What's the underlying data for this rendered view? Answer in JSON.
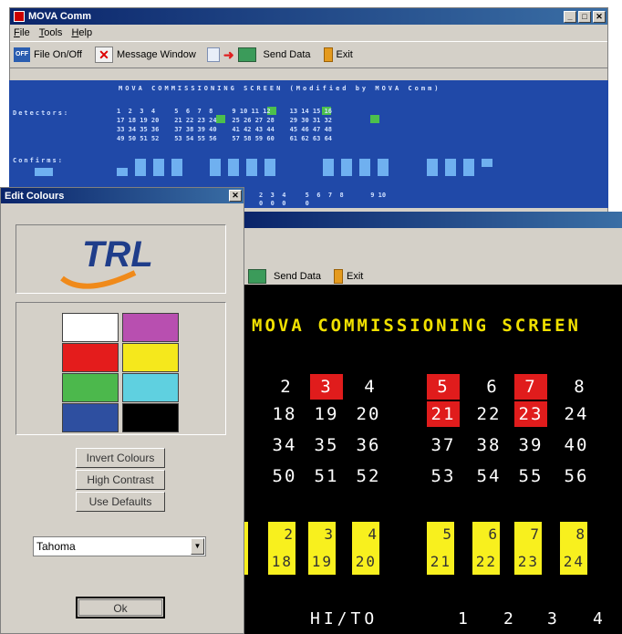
{
  "main_window": {
    "title": "MOVA Comm",
    "menu": [
      "File",
      "Tools",
      "Help"
    ],
    "toolbar": {
      "file_onoff": "File On/Off",
      "off_icon_text": "OFF",
      "message_window": "Message Window",
      "send_data": "Send Data",
      "exit": "Exit"
    }
  },
  "blue_screen": {
    "title": "MOVA COMMISSIONING SCREEN (Modified by MOVA Comm)",
    "detectors_label": "Detectors:",
    "confirms_label": "Confirms:",
    "detector_rows": [
      "1  2  3  4     5  6  7  8     9 10 11 12     13 14 15 16",
      "17 18 19 20    21 22 23 24    25 26 27 28    29 30 31 32",
      "33 34 35 36    37 38 39 40    41 42 43 44    45 46 47 48",
      "49 50 51 52    53 54 55 56    57 58 59 60    61 62 63 64"
    ],
    "lower_row_1": "2  3  4     5  6  7  8       9 10",
    "lower_row_2": "0  0  0     0"
  },
  "edit_colours": {
    "title": "Edit Colours",
    "logo_text": "TRL",
    "swatches": [
      "#ffffff",
      "#b84fb0",
      "#e41c1c",
      "#f5e81c",
      "#4cb84c",
      "#5fd0e0",
      "#2e4fa0",
      "#000000"
    ],
    "buttons": {
      "invert": "Invert Colours",
      "high_contrast": "High Contrast",
      "defaults": "Use Defaults"
    },
    "font_select": "Tahoma",
    "ok": "Ok"
  },
  "black_screen": {
    "toolbar_send": "Send Data",
    "toolbar_exit": "Exit",
    "title": "MOVA COMMISSIONING SCREEN",
    "rows": [
      [
        "2",
        "3",
        "4",
        "5",
        "6",
        "7",
        "8"
      ],
      [
        "18",
        "19",
        "20",
        "21",
        "22",
        "23",
        "24"
      ],
      [
        "34",
        "35",
        "36",
        "37",
        "38",
        "39",
        "40"
      ],
      [
        "50",
        "51",
        "52",
        "53",
        "54",
        "55",
        "56"
      ]
    ],
    "confirms_top": [
      "2",
      "3",
      "4",
      "5",
      "6",
      "7",
      "8"
    ],
    "confirms_bottom": [
      "18",
      "19",
      "20",
      "21",
      "22",
      "23",
      "24"
    ],
    "hito": "HI/TO",
    "hito_nums": [
      "1",
      "2",
      "3",
      "4"
    ]
  },
  "colors": {
    "highlight_red": "#e01c1c",
    "confirm_yellow": "#f8f01e",
    "title_yellow": "#f0e000"
  }
}
